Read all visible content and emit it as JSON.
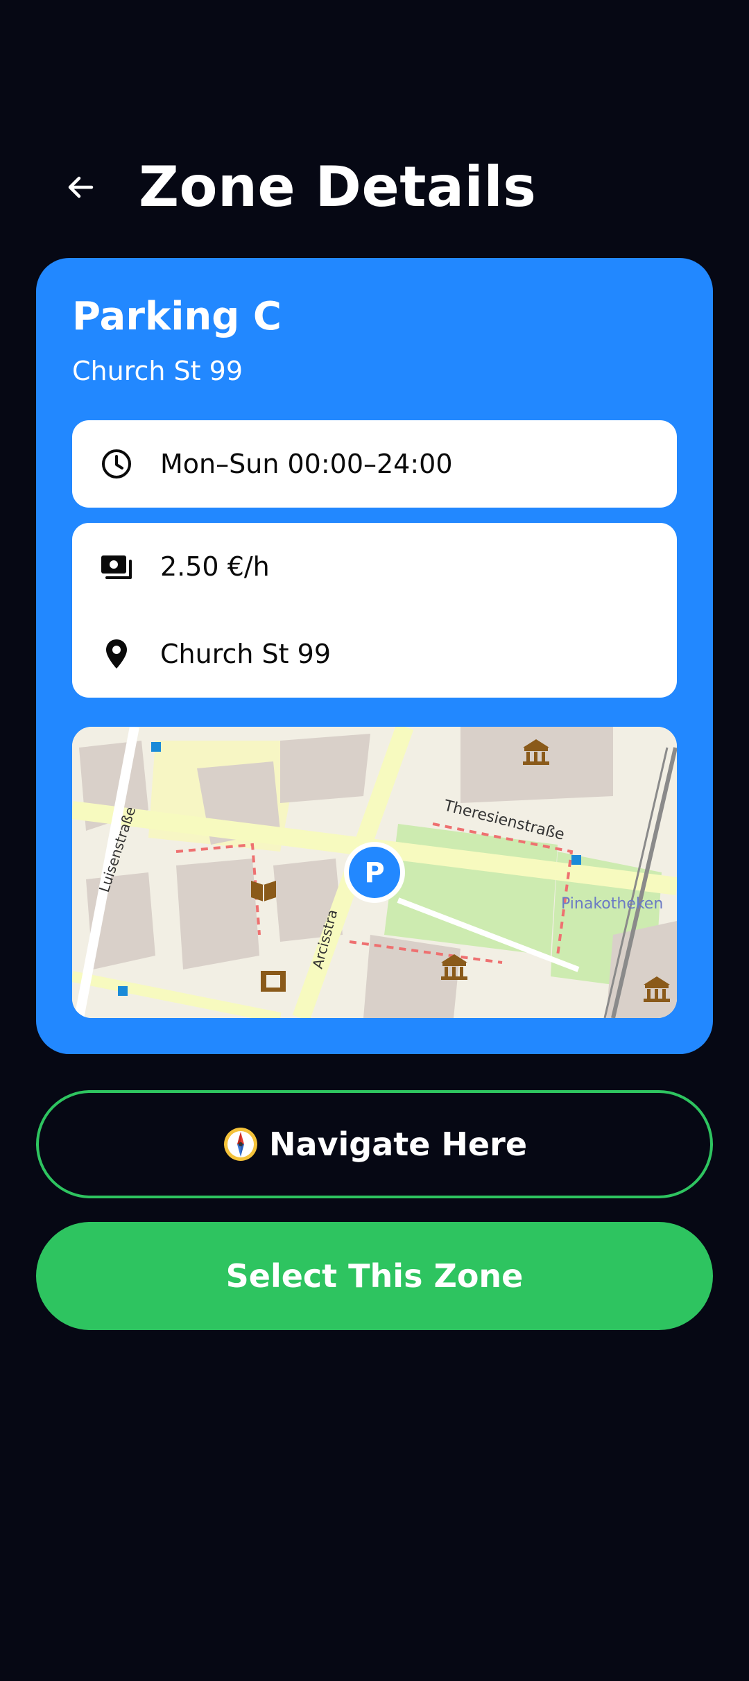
{
  "header": {
    "title": "Zone Details",
    "back_icon": "arrow-left-icon"
  },
  "zone": {
    "name": "Parking C",
    "address": "Church St 99",
    "hours": {
      "icon": "clock-icon",
      "text": "Mon–Sun 00:00–24:00"
    },
    "rate": {
      "icon": "money-icon",
      "text": "2.50 €/h"
    },
    "location": {
      "icon": "location-pin-icon",
      "text": "Church St 99"
    }
  },
  "map": {
    "marker_label": "P",
    "street_labels": [
      "Luisenstraße",
      "Theresienstraße",
      "Arcisstra",
      "Pinakotheken"
    ]
  },
  "actions": {
    "navigate_label": "Navigate Here",
    "navigate_icon": "compass-icon",
    "select_label": "Select This Zone"
  },
  "colors": {
    "background": "#060814",
    "card": "#2288ff",
    "accent_green": "#2ec460"
  }
}
